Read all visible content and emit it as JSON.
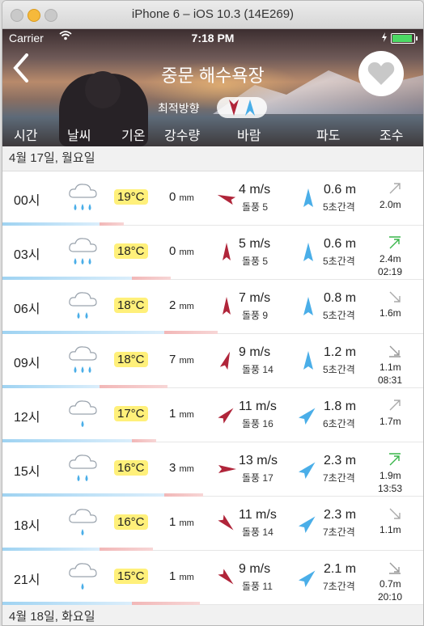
{
  "window": {
    "title": "iPhone 6 – iOS 10.3 (14E269)"
  },
  "status": {
    "carrier": "Carrier",
    "time": "7:18 PM"
  },
  "header": {
    "title": "중문 해수욕장",
    "optimal_label": "최적방향"
  },
  "columns": [
    "시간",
    "날씨",
    "기온",
    "강수량",
    "바람",
    "파도",
    "조수"
  ],
  "days": [
    {
      "date": "4월 17일, 월요일"
    },
    {
      "date": "4월 18일, 화요일"
    }
  ],
  "units": {
    "rain": "mm"
  },
  "rows": [
    {
      "time": "00시",
      "weather": "cloudy",
      "temp": "19°C",
      "rain": "0",
      "wind": "4 m/s",
      "gust": "돌풍 5",
      "wind_dir": "east-southeast",
      "wave": "0.6 m",
      "period": "5초간격",
      "tide_level": "2.0m",
      "tide_time": "",
      "tide_dir": "up",
      "tide_color": "#aaaaaa"
    },
    {
      "time": "03시",
      "weather": "cloudy",
      "temp": "18°C",
      "rain": "0",
      "wind": "5 m/s",
      "gust": "돌풍 5",
      "wind_dir": "south",
      "wave": "0.6 m",
      "period": "5초간격",
      "tide_level": "2.4m",
      "tide_time": "02:19",
      "tide_dir": "up-peak",
      "tide_color": "#39b54a"
    },
    {
      "time": "06시",
      "weather": "rain-light",
      "temp": "18°C",
      "rain": "2",
      "wind": "7 m/s",
      "gust": "돌풍 9",
      "wind_dir": "south",
      "wave": "0.8 m",
      "period": "5초간격",
      "tide_level": "1.6m",
      "tide_time": "",
      "tide_dir": "down",
      "tide_color": "#aaaaaa"
    },
    {
      "time": "09시",
      "weather": "rain-heavy",
      "temp": "18°C",
      "rain": "7",
      "wind": "9 m/s",
      "gust": "돌풍 14",
      "wind_dir": "south-southwest",
      "wave": "1.2 m",
      "period": "5초간격",
      "tide_level": "1.1m",
      "tide_time": "08:31",
      "tide_dir": "down-low",
      "tide_color": "#999999"
    },
    {
      "time": "12시",
      "weather": "rain-drop",
      "temp": "17°C",
      "rain": "1",
      "wind": "11 m/s",
      "gust": "돌풍 16",
      "wind_dir": "southwest",
      "wave": "1.8 m",
      "period": "6초간격",
      "tide_level": "1.7m",
      "tide_time": "",
      "tide_dir": "up",
      "tide_color": "#aaaaaa"
    },
    {
      "time": "15시",
      "weather": "rain-light",
      "temp": "16°C",
      "rain": "3",
      "wind": "13 m/s",
      "gust": "돌풍 17",
      "wind_dir": "west",
      "wave": "2.3 m",
      "period": "7초간격",
      "tide_level": "1.9m",
      "tide_time": "13:53",
      "tide_dir": "up-peak",
      "tide_color": "#39b54a"
    },
    {
      "time": "18시",
      "weather": "rain-drop",
      "temp": "16°C",
      "rain": "1",
      "wind": "11 m/s",
      "gust": "돌풍 14",
      "wind_dir": "northwest",
      "wave": "2.3 m",
      "period": "7초간격",
      "tide_level": "1.1m",
      "tide_time": "",
      "tide_dir": "down",
      "tide_color": "#aaaaaa"
    },
    {
      "time": "21시",
      "weather": "rain-drop",
      "temp": "15°C",
      "rain": "1",
      "wind": "9 m/s",
      "gust": "돌풍 11",
      "wind_dir": "northwest",
      "wave": "2.1 m",
      "period": "7초간격",
      "tide_level": "0.7m",
      "tide_time": "20:10",
      "tide_dir": "down-low",
      "tide_color": "#999999"
    }
  ],
  "colors": {
    "wind_arrow": "#b0253a",
    "wave_arrow": "#4aaee8",
    "temp_badge": "#fff07a"
  }
}
